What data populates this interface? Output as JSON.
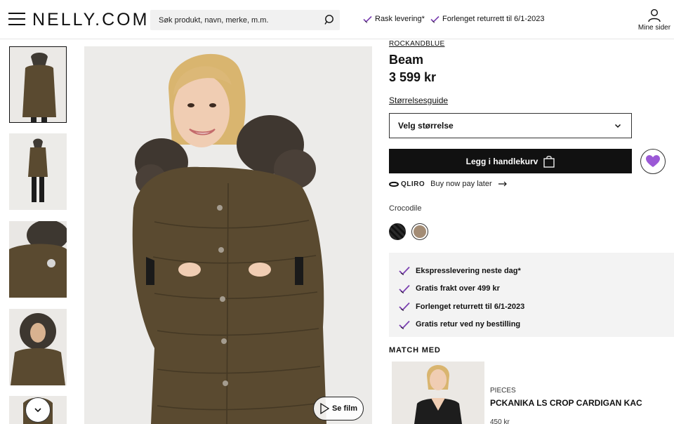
{
  "header": {
    "logo": "NELLY.COM",
    "search_placeholder": "Søk produkt, navn, merke, m.m.",
    "usps": [
      "Rask levering*",
      "Forlenget returrett til 6/1-2023"
    ],
    "account_label": "Mine sider"
  },
  "product": {
    "brand": "ROCKANDBLUE",
    "name": "Beam",
    "price": "3 599 kr",
    "size_guide": "Størrelsesguide",
    "size_select": "Velg størrelse",
    "add_to_cart": "Legg i handlekurv",
    "qliro_logo": "QLIRO",
    "qliro_text": "Buy now pay later",
    "color_name": "Crocodile",
    "film_label": "Se film"
  },
  "usp_box": [
    "Ekspresslevering neste dag*",
    "Gratis frakt over 499 kr",
    "Forlenget returrett til 6/1-2023",
    "Gratis retur ved ny bestilling"
  ],
  "match": {
    "heading": "MATCH MED",
    "brand": "PIECES",
    "name": "PCKANIKA LS CROP CARDIGAN KAC",
    "price": "450 kr"
  },
  "colors": {
    "accent": "#7a3fb0",
    "wishlist": "#9b59d6",
    "jacket": "#5a4a30",
    "swatch_black": "#1d1d1d",
    "swatch_taupe": "#a38c75"
  },
  "icons": [
    "hamburger-icon",
    "search-icon",
    "check-icon",
    "user-icon",
    "chevron-down-icon",
    "bag-icon",
    "heart-icon",
    "arrow-right-icon",
    "play-icon"
  ]
}
